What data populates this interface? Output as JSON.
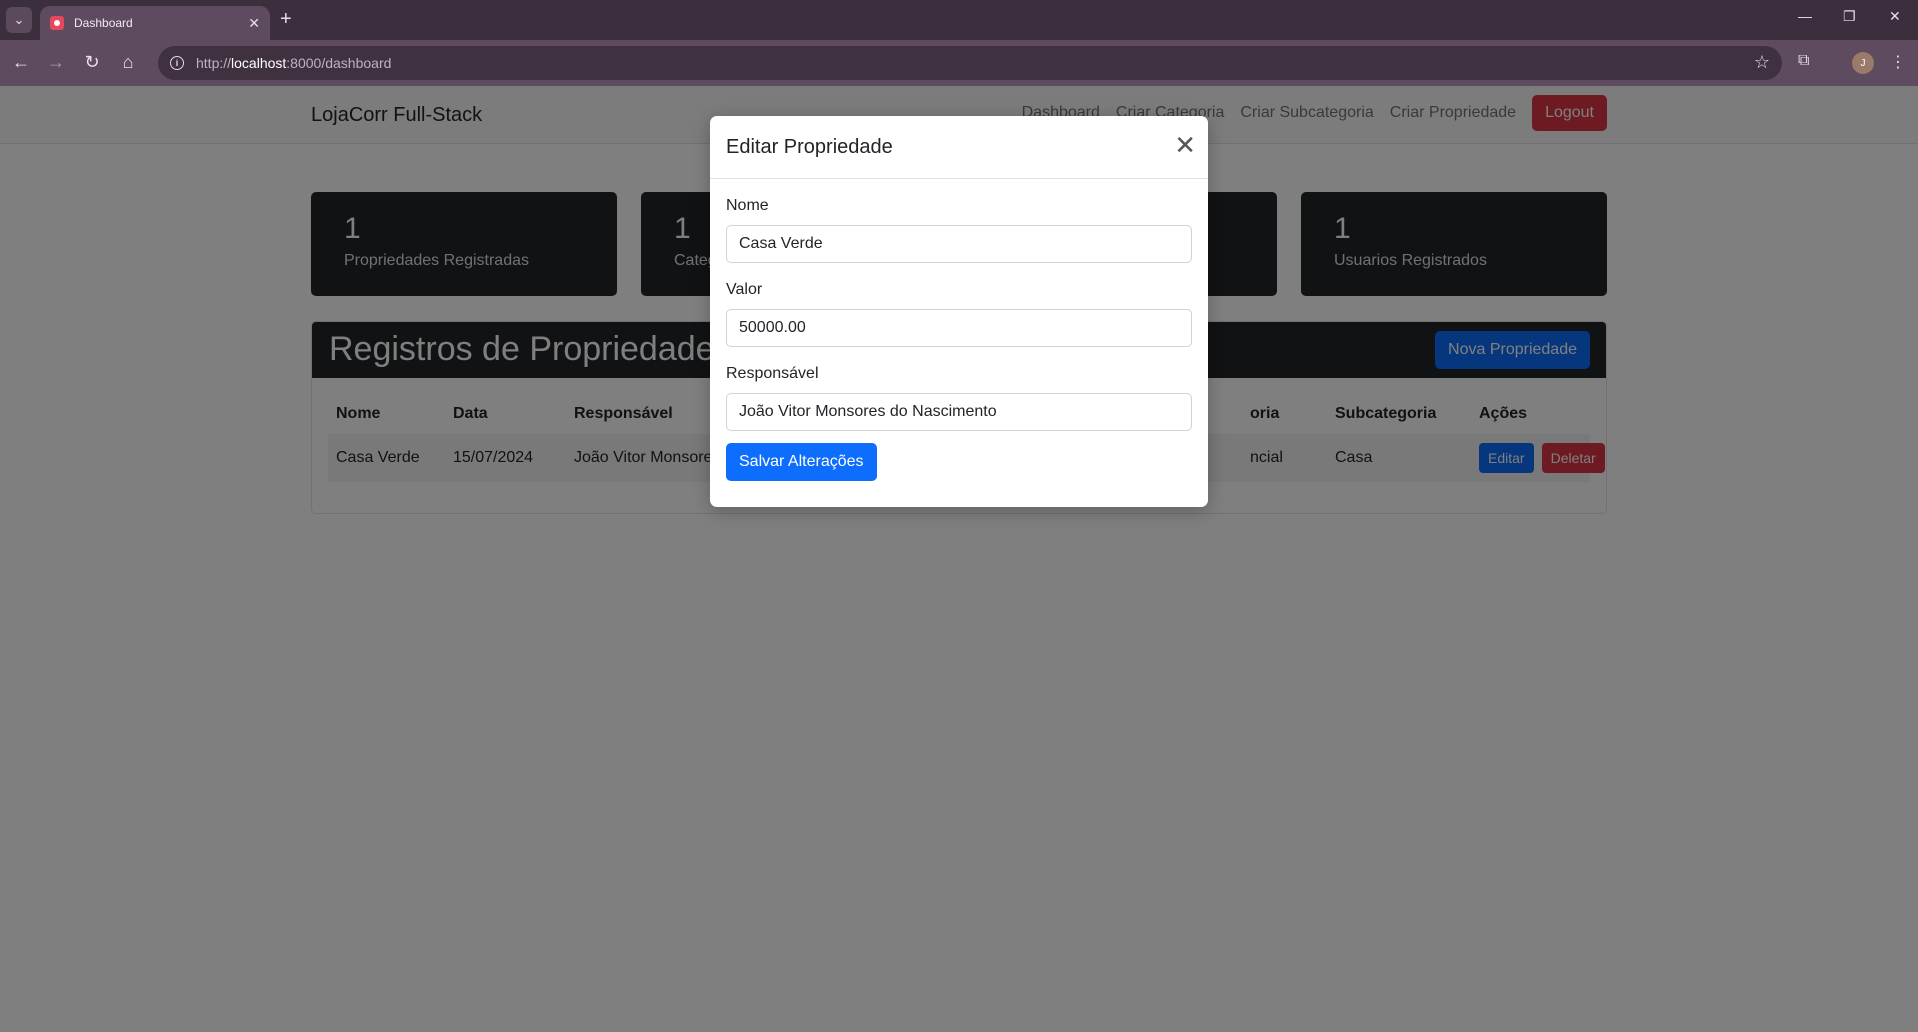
{
  "browser": {
    "tab_title": "Dashboard",
    "url_prefix": "http://",
    "url_host": "localhost",
    "url_rest": ":8000/dashboard",
    "avatar_letter": "J"
  },
  "navbar": {
    "brand": "LojaCorr Full-Stack",
    "links": [
      "Dashboard",
      "Criar Categoria",
      "Criar Subcategoria",
      "Criar Propriedade"
    ],
    "logout": "Logout"
  },
  "cards": [
    {
      "count": "1",
      "label": "Propriedades Registradas"
    },
    {
      "count": "1",
      "label": "Categ"
    },
    {
      "count": "",
      "label": ""
    },
    {
      "count": "1",
      "label": "Usuarios Registrados"
    }
  ],
  "registros": {
    "title": "Registros de Propriedade",
    "new_button": "Nova Propriedade",
    "columns": [
      "Nome",
      "Data",
      "Responsável",
      "",
      "oria",
      "Subcategoria",
      "Ações"
    ],
    "row": {
      "nome": "Casa Verde",
      "data": "15/07/2024",
      "responsavel": "João Vitor Monsore",
      "categoria": "ncial",
      "subcategoria": "Casa",
      "edit": "Editar",
      "delete": "Deletar"
    }
  },
  "modal": {
    "title": "Editar Propriedade",
    "close_glyph": "✕",
    "fields": {
      "nome_label": "Nome",
      "nome_value": "Casa Verde",
      "valor_label": "Valor",
      "valor_value": "50000.00",
      "responsavel_label": "Responsável",
      "responsavel_value": "João Vitor Monsores do Nascimento"
    },
    "save_button": "Salvar Alterações"
  },
  "colors": {
    "primary": "#0d6efd",
    "danger": "#dc3545",
    "dark": "#212529",
    "chrome": "#5e4b5f"
  }
}
